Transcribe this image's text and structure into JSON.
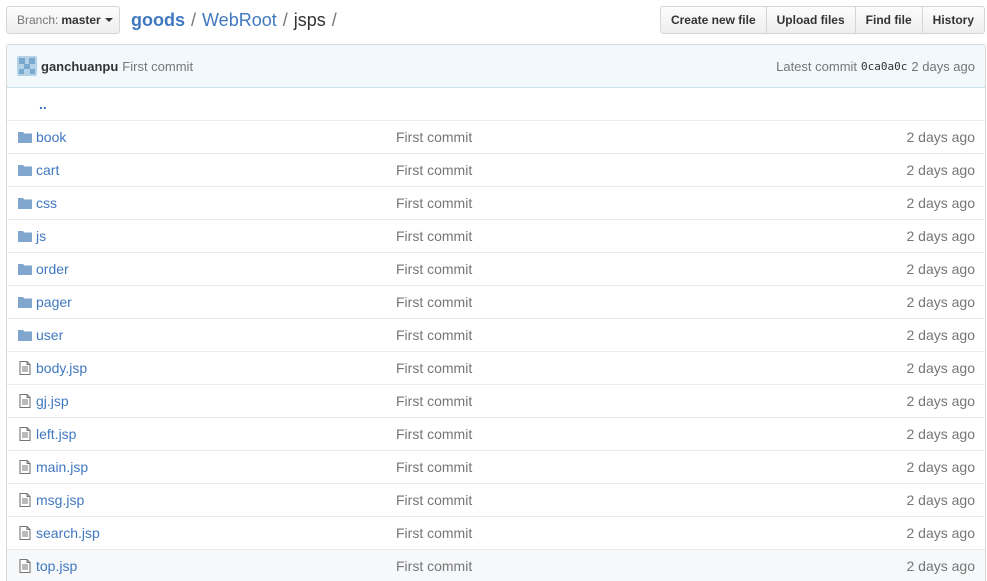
{
  "branch": {
    "label": "Branch:",
    "value": "master"
  },
  "breadcrumb": {
    "repo": "goods",
    "dir": "WebRoot",
    "current": "jsps",
    "sep": "/"
  },
  "buttons": {
    "create": "Create new file",
    "upload": "Upload files",
    "find": "Find file",
    "history": "History"
  },
  "commit": {
    "author": "ganchuanpu",
    "message": "First commit",
    "latest_label": "Latest commit",
    "sha": "0ca0a0c",
    "age": "2 days ago"
  },
  "parent": "..",
  "files": [
    {
      "name": "book",
      "type": "dir",
      "message": "First commit",
      "age": "2 days ago"
    },
    {
      "name": "cart",
      "type": "dir",
      "message": "First commit",
      "age": "2 days ago"
    },
    {
      "name": "css",
      "type": "dir",
      "message": "First commit",
      "age": "2 days ago"
    },
    {
      "name": "js",
      "type": "dir",
      "message": "First commit",
      "age": "2 days ago"
    },
    {
      "name": "order",
      "type": "dir",
      "message": "First commit",
      "age": "2 days ago"
    },
    {
      "name": "pager",
      "type": "dir",
      "message": "First commit",
      "age": "2 days ago"
    },
    {
      "name": "user",
      "type": "dir",
      "message": "First commit",
      "age": "2 days ago"
    },
    {
      "name": "body.jsp",
      "type": "file",
      "message": "First commit",
      "age": "2 days ago"
    },
    {
      "name": "gj.jsp",
      "type": "file",
      "message": "First commit",
      "age": "2 days ago"
    },
    {
      "name": "left.jsp",
      "type": "file",
      "message": "First commit",
      "age": "2 days ago"
    },
    {
      "name": "main.jsp",
      "type": "file",
      "message": "First commit",
      "age": "2 days ago"
    },
    {
      "name": "msg.jsp",
      "type": "file",
      "message": "First commit",
      "age": "2 days ago"
    },
    {
      "name": "search.jsp",
      "type": "file",
      "message": "First commit",
      "age": "2 days ago"
    },
    {
      "name": "top.jsp",
      "type": "file",
      "message": "First commit",
      "age": "2 days ago"
    }
  ],
  "colors": {
    "link": "#4078c0",
    "folder": "#80a6cd",
    "muted": "#767676",
    "tease_bg": "#f2f9fc"
  }
}
